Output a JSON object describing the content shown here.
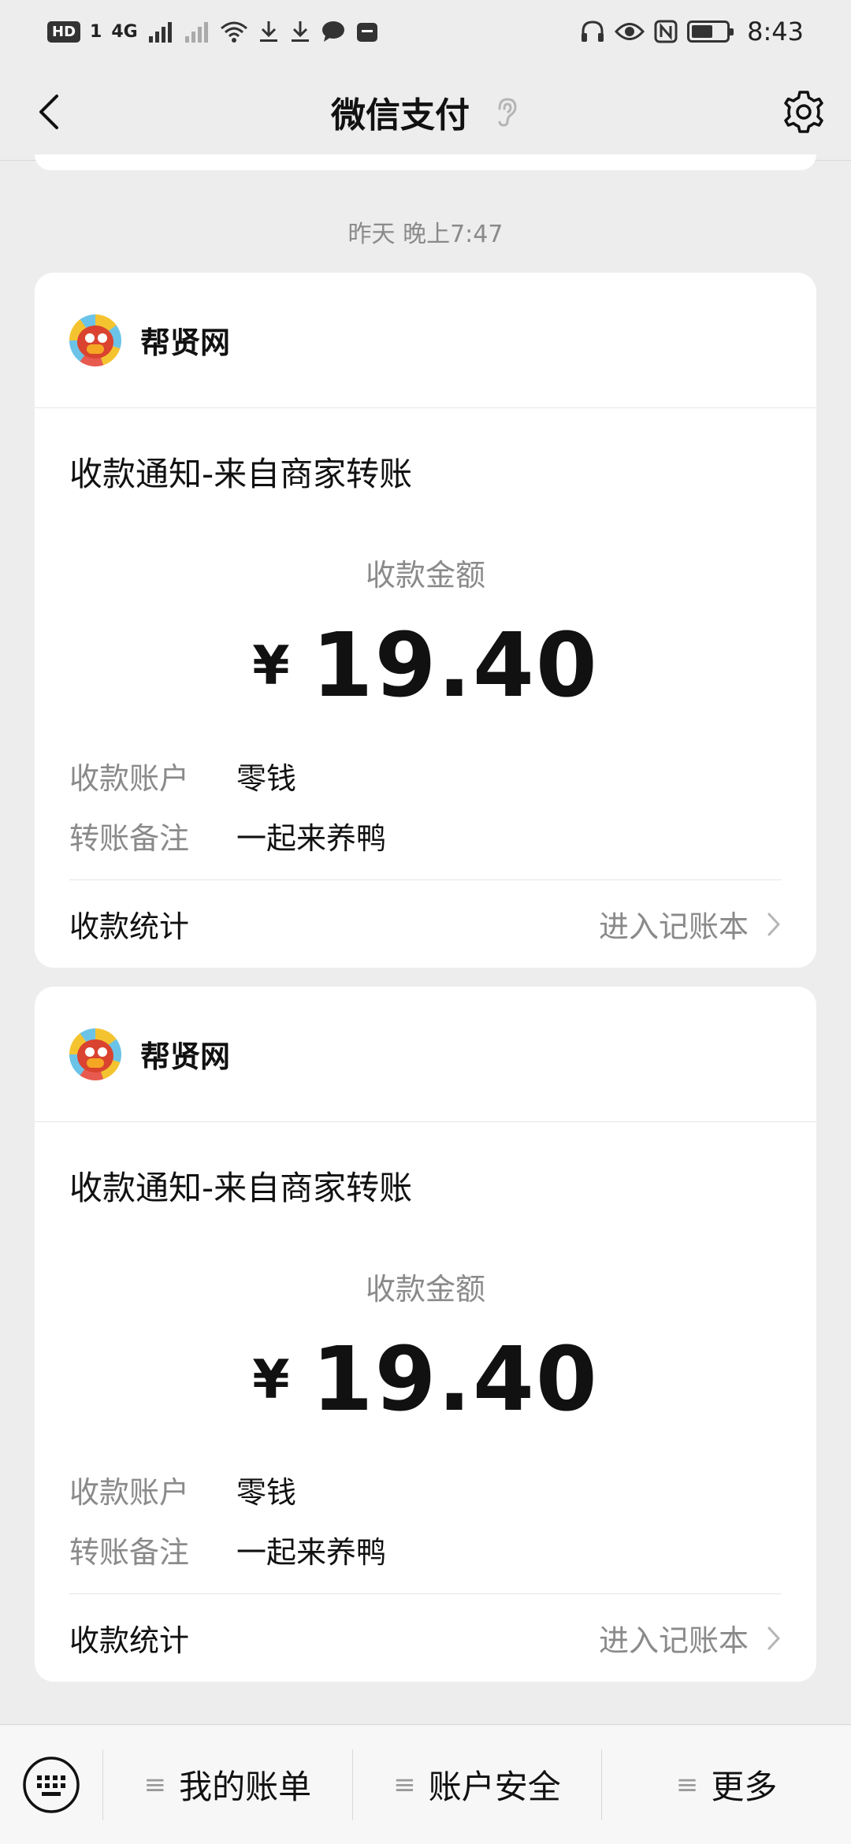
{
  "status_bar": {
    "left_badge": "HD",
    "sim": "1",
    "network": "4G",
    "time": "8:43"
  },
  "header": {
    "title": "微信支付"
  },
  "timestamp": "昨天 晚上7:47",
  "messages": [
    {
      "merchant": "帮贤网",
      "title": "收款通知-来自商家转账",
      "amount_label": "收款金额",
      "currency": "¥",
      "amount": "19.40",
      "account_label": "收款账户",
      "account_value": "零钱",
      "remark_label": "转账备注",
      "remark_value": "一起来养鸭",
      "stats_label": "收款统计",
      "stats_link": "进入记账本"
    },
    {
      "merchant": "帮贤网",
      "title": "收款通知-来自商家转账",
      "amount_label": "收款金额",
      "currency": "¥",
      "amount": "19.40",
      "account_label": "收款账户",
      "account_value": "零钱",
      "remark_label": "转账备注",
      "remark_value": "一起来养鸭",
      "stats_label": "收款统计",
      "stats_link": "进入记账本"
    }
  ],
  "bottom_menu": {
    "menu_icon": "≡",
    "items": [
      "我的账单",
      "账户安全",
      "更多"
    ]
  },
  "colors": {
    "background": "#ededed",
    "card": "#ffffff",
    "secondary_text": "#8a8a8a",
    "primary_text": "#111111"
  }
}
